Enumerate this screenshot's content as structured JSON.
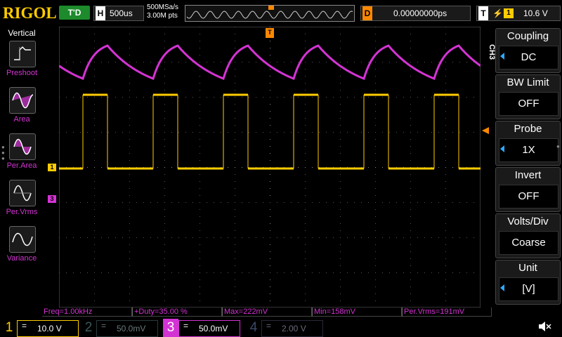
{
  "brand": "RIGOL",
  "top": {
    "trigger_status": "T'D",
    "horizontal_key": "H",
    "timebase": "500us",
    "sample_rate": "500MSa/s",
    "memory_depth": "3.00M pts",
    "delay_key": "D",
    "delay": "0.00000000ps",
    "trigger_key": "T",
    "trigger_edge": "rising-edge-icon",
    "trigger_source": "1",
    "trigger_level": "10.6 V"
  },
  "left_panel": {
    "title": "Vertical",
    "items": [
      {
        "label": "Preshoot",
        "icon": "preshoot-icon"
      },
      {
        "label": "Area",
        "icon": "area-icon"
      },
      {
        "label": "Per.Area",
        "icon": "period-area-icon"
      },
      {
        "label": "Per.Vrms",
        "icon": "period-vrms-icon"
      },
      {
        "label": "Variance",
        "icon": "variance-icon"
      }
    ]
  },
  "markers": {
    "ch1_marker": "1",
    "ch3_marker": "3",
    "trigger_pos_marker": "T"
  },
  "right_menu": {
    "channel": "CH3",
    "items": [
      {
        "title": "Coupling",
        "value": "DC",
        "has_arrow": true
      },
      {
        "title": "BW Limit",
        "value": "OFF",
        "has_arrow": false
      },
      {
        "title": "Probe",
        "value": "1X",
        "has_arrow": true
      },
      {
        "title": "Invert",
        "value": "OFF",
        "has_arrow": false
      },
      {
        "title": "Volts/Div",
        "value": "Coarse",
        "has_arrow": false
      },
      {
        "title": "Unit",
        "value": "[V]",
        "has_arrow": true
      }
    ]
  },
  "measurements": [
    {
      "text": "Freq=1.00kHz"
    },
    {
      "text": "+Duty=35.00 %"
    },
    {
      "text": "Max=222mV"
    },
    {
      "text": "Min=158mV"
    },
    {
      "text": "Per.Vrms=191mV"
    }
  ],
  "channels": [
    {
      "num": "1",
      "coupling": "=",
      "scale": "10.0 V",
      "active": true
    },
    {
      "num": "2",
      "coupling": "=",
      "scale": "50.0mV",
      "active": false
    },
    {
      "num": "3",
      "coupling": "=",
      "scale": "50.0mV",
      "active": true
    },
    {
      "num": "4",
      "coupling": "=",
      "scale": "2.00 V",
      "active": false
    }
  ],
  "colors": {
    "ch1": "#ffcc00",
    "ch3": "#d433d4",
    "trigger": "#ff8800",
    "accent": "#2fa9ff"
  },
  "waveforms": {
    "period_divs": 2,
    "duty": 0.35,
    "ch3_max_mV": 222,
    "ch3_min_mV": 158
  }
}
